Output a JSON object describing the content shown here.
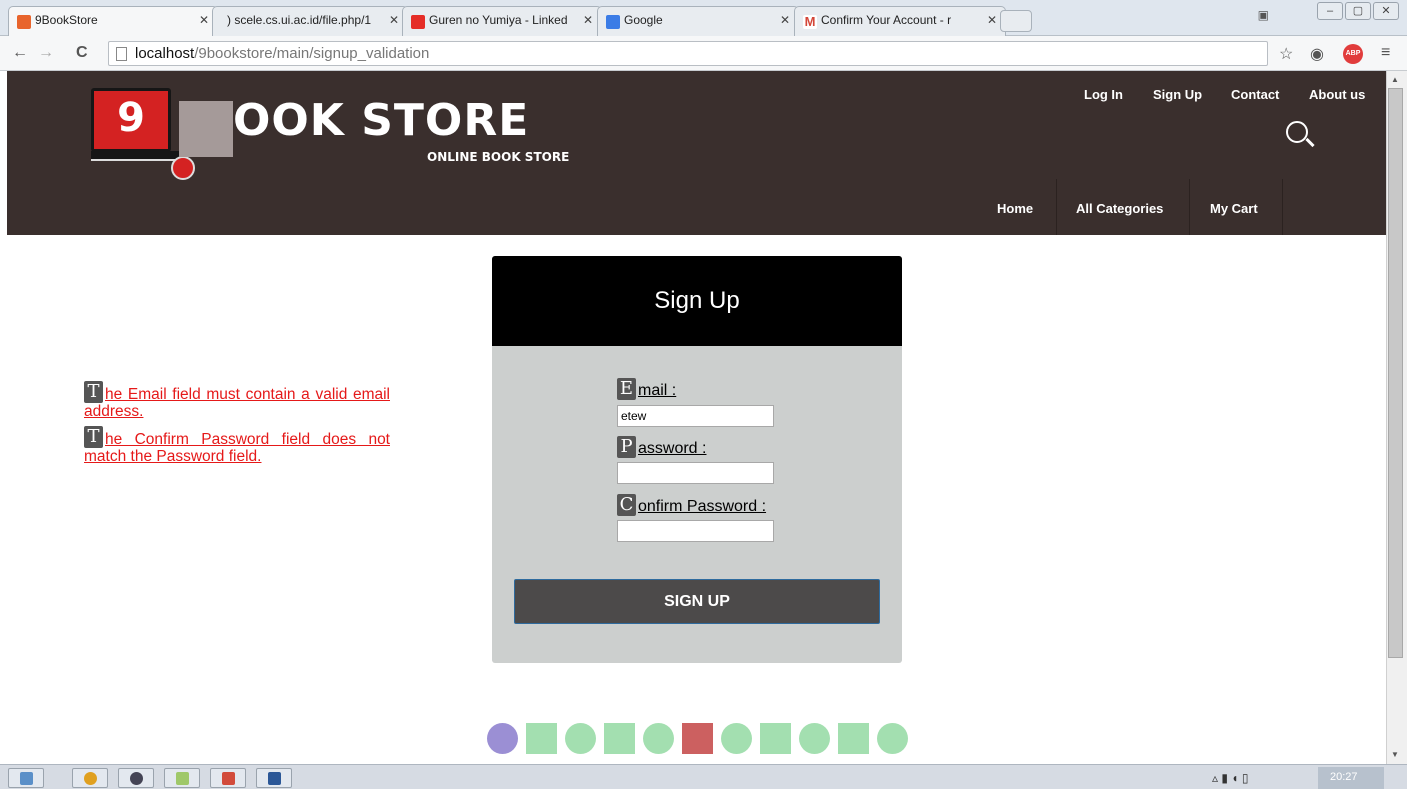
{
  "browser": {
    "tabs": [
      {
        "title": "9BookStore",
        "color": "#e8642c"
      },
      {
        "title": ") scele.cs.ui.ac.id/file.php/1",
        "color": "#cccccc"
      },
      {
        "title": "Guren no Yumiya - Linked",
        "color": "#e52d27"
      },
      {
        "title": "Google",
        "color": "#3b7ce6"
      },
      {
        "title": "Confirm Your Account - r",
        "color": "#d44638"
      }
    ],
    "url_host": "localhost",
    "url_path": "/9bookstore/main/signup_validation",
    "abp_label": "ABP"
  },
  "site": {
    "logo_number": "9",
    "logo_title": "OOK STORE",
    "logo_sub": "ONLINE BOOK STORE",
    "top_nav": [
      "Log In",
      "Sign Up",
      "Contact",
      "About us"
    ],
    "main_nav": [
      "Home",
      "All Categories",
      "My Cart"
    ]
  },
  "errors": [
    {
      "cap": "T",
      "text": "he Email field must contain a valid email address."
    },
    {
      "cap": "T",
      "text": "he Confirm Password field does not match the Password field."
    }
  ],
  "signup": {
    "title": "Sign Up",
    "email": {
      "cap": "E",
      "label": "mail :",
      "value": "etew"
    },
    "password": {
      "cap": "P",
      "label": "assword :",
      "value": ""
    },
    "confirm": {
      "cap": "C",
      "label": "onfirm Password :",
      "value": ""
    },
    "submit_label": "SIGN UP"
  },
  "taskbar": {
    "clock": "20:27"
  },
  "colors": {
    "header_bg": "#3a2f2d",
    "error_red": "#e51919",
    "card_bg": "#cccfce",
    "button_bg": "#4c4a4a"
  }
}
